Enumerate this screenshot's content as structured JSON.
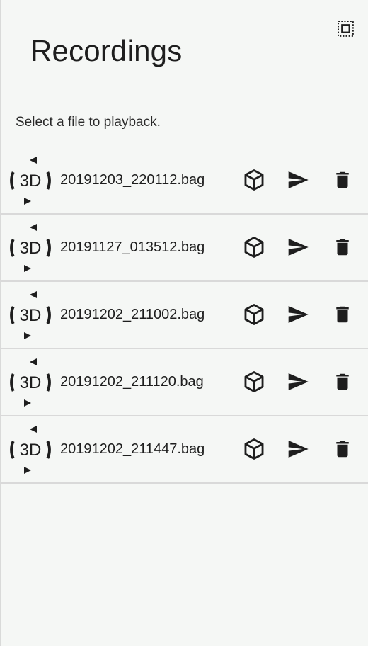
{
  "header": {
    "title": "Recordings",
    "select_icon": "select-all-icon"
  },
  "instruction": "Select a file to playback.",
  "row_icons": {
    "thumbnail": "3d-rotate-icon",
    "thumbnail_text": "3D",
    "view": "cube-icon",
    "share": "send-icon",
    "delete": "trash-icon"
  },
  "files": [
    {
      "name": "20191203_220112.bag"
    },
    {
      "name": "20191127_013512.bag"
    },
    {
      "name": "20191202_211002.bag"
    },
    {
      "name": "20191202_211120.bag"
    },
    {
      "name": "20191202_211447.bag"
    }
  ]
}
